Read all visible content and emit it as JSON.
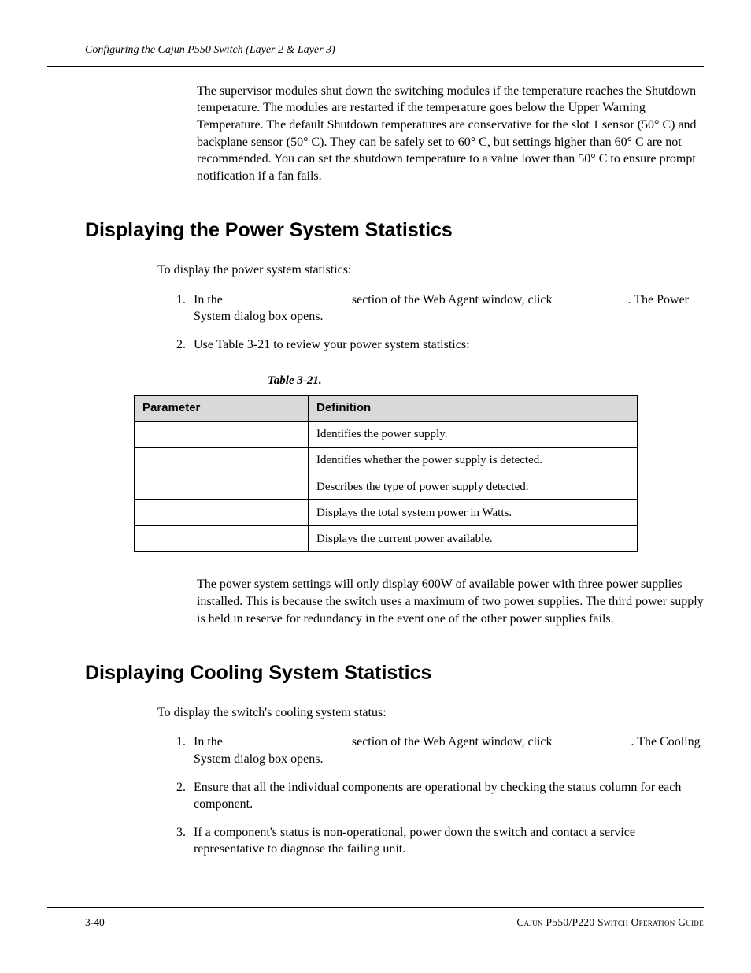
{
  "header": {
    "running": "Configuring the Cajun P550 Switch (Layer 2 & Layer 3)"
  },
  "intro_para": "The supervisor modules shut down the switching modules if the temperature reaches the Shutdown temperature. The modules are restarted if the temperature goes below the Upper Warning Temperature. The default Shutdown temperatures are conservative for the slot 1 sensor (50° C) and backplane sensor (50° C). They can be safely set to 60° C, but settings higher than 60° C are not recommended. You can set the shutdown temperature to a value lower than 50° C to ensure prompt notification if a fan fails.",
  "section1": {
    "title": "Displaying the Power System Statistics",
    "intro": "To display the power system statistics:",
    "step1": "In the                                         section of the Web Agent window, click                        . The Power System dialog box opens.",
    "step2": "Use Table 3-21 to review your power system statistics:",
    "table_caption": "Table 3-21.",
    "table": {
      "head_param": "Parameter",
      "head_def": "Definition",
      "rows": [
        {
          "param": "",
          "def": "Identifies the power supply."
        },
        {
          "param": "",
          "def": "Identifies whether the power supply is detected."
        },
        {
          "param": "",
          "def": "Describes the type of power supply detected."
        },
        {
          "param": "",
          "def": "Displays the total system power in Watts."
        },
        {
          "param": "",
          "def": "Displays the current power available."
        }
      ]
    },
    "note": "The power system settings will only display 600W of available power with three power supplies installed. This is because the switch uses a maximum of two power supplies. The third power supply is held in reserve for redundancy in the event one of the other power supplies fails."
  },
  "section2": {
    "title": "Displaying Cooling System Statistics",
    "intro": "To display the switch's cooling system status:",
    "step1": "In the                                         section of the Web Agent window, click                         . The Cooling System dialog box opens.",
    "step2": "Ensure that all the individual components are operational by checking the status column for each component.",
    "step3": "If a component's status is non-operational, power down the switch and contact a service representative to diagnose the failing unit."
  },
  "footer": {
    "page": "3-40",
    "guide": "Cajun P550/P220 Switch Operation Guide"
  }
}
